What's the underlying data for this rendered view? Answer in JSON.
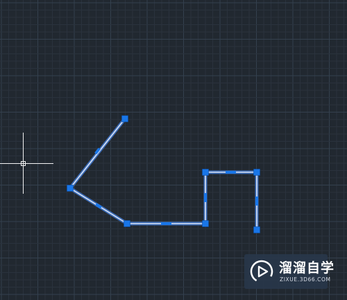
{
  "viewport": {
    "background_color": "#212830",
    "grid_minor_color": "#2a323d",
    "grid_major_color": "#34404e"
  },
  "drawing": {
    "polyline_color": "#c9d8f0",
    "grip_color": "#1976e8"
  },
  "watermark": {
    "title": "溜溜自学",
    "url": "ZIXUE.3D66.COM",
    "icon": "play-triangle-icon"
  }
}
